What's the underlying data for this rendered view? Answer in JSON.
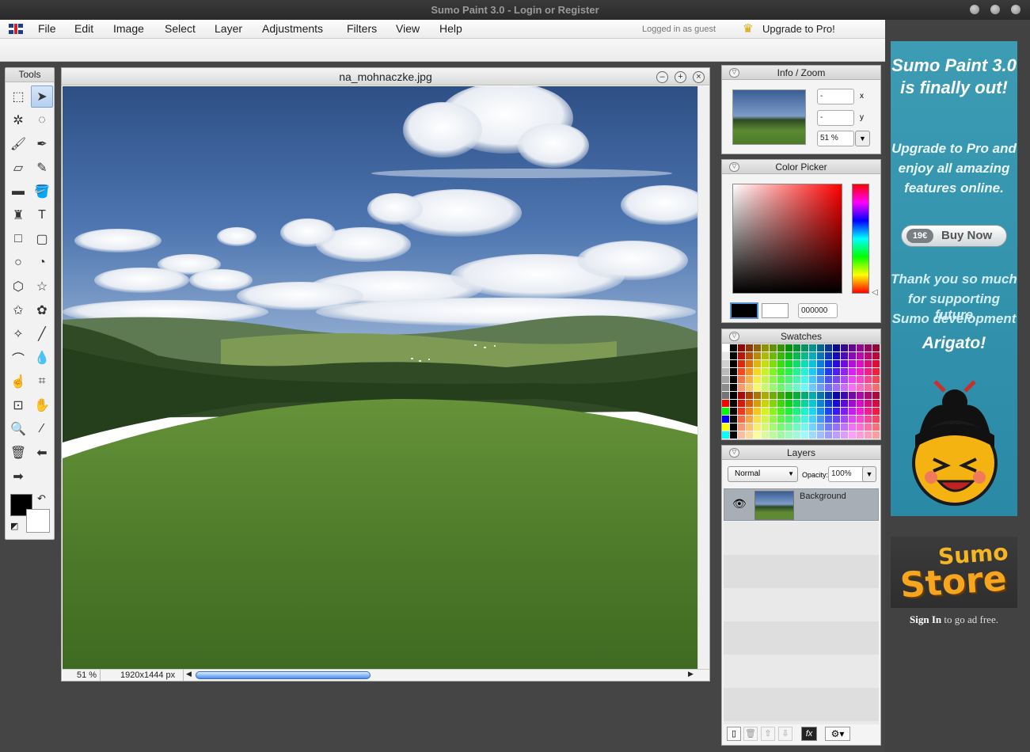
{
  "window": {
    "title": "Sumo Paint 3.0 - Login or Register"
  },
  "menu": {
    "items": [
      "File",
      "Edit",
      "Image",
      "Select",
      "Layer",
      "Adjustments",
      "Filters",
      "View",
      "Help"
    ],
    "logged_in": "Logged in as guest",
    "upgrade": "Upgrade to Pro!"
  },
  "tools": {
    "title": "Tools",
    "icons": [
      "marquee-tool",
      "move-tool",
      "magic-wand-tool",
      "lasso-tool",
      "brush-tool",
      "ink-brush-tool",
      "eraser-tool",
      "pencil-tool",
      "gradient-tool",
      "fill-tool",
      "clone-stamp-tool",
      "text-tool",
      "rectangle-tool",
      "rounded-rectangle-tool",
      "ellipse-tool",
      "arc-tool",
      "polygon-tool",
      "star-tool",
      "star-outline-tool",
      "flower-tool",
      "squiggle-tool",
      "line-tool",
      "curve-tool",
      "blur-drop-tool",
      "smudge-tool",
      "crop-tool",
      "transform-tool",
      "hand-tool",
      "zoom-tool",
      "eyedropper-tool",
      "trash-tool",
      "undo-arrow",
      "redo-arrow"
    ],
    "primary_color": "#000000",
    "secondary_color": "#ffffff"
  },
  "document": {
    "filename": "na_mohnaczke.jpg",
    "zoom": "51 %",
    "dimensions": "1920x1444 px"
  },
  "info_zoom": {
    "title": "Info / Zoom",
    "x_value": "-",
    "y_value": "-",
    "x_label": "x",
    "y_label": "y",
    "zoom": "51 %"
  },
  "color_picker": {
    "title": "Color Picker",
    "hex": "000000",
    "primary": "#000000",
    "secondary": "#ffffff"
  },
  "swatches": {
    "title": "Swatches"
  },
  "layers": {
    "title": "Layers",
    "blend_mode": "Normal",
    "opacity_label": "Opacity:",
    "opacity": "100%",
    "items": [
      {
        "name": "Background"
      }
    ]
  },
  "ad": {
    "headline1": "Sumo Paint 3.0",
    "headline2": "is finally out!",
    "body1": "Upgrade to Pro and",
    "body2": "enjoy all amazing",
    "body3": "features online.",
    "price": "19€",
    "buy": "Buy Now",
    "thanks1": "Thank you so much",
    "thanks2": "for supporting future",
    "thanks3": "Sumo development",
    "arigato": "Arigato!",
    "store1": "Sumo",
    "store2": "Store",
    "signin": "Sign In",
    "signin_rest": "to go ad free."
  },
  "colors": {
    "ad_bg": "#2e8fab",
    "selection_blue": "#b5cfee",
    "accent_red": "#ff0000"
  }
}
